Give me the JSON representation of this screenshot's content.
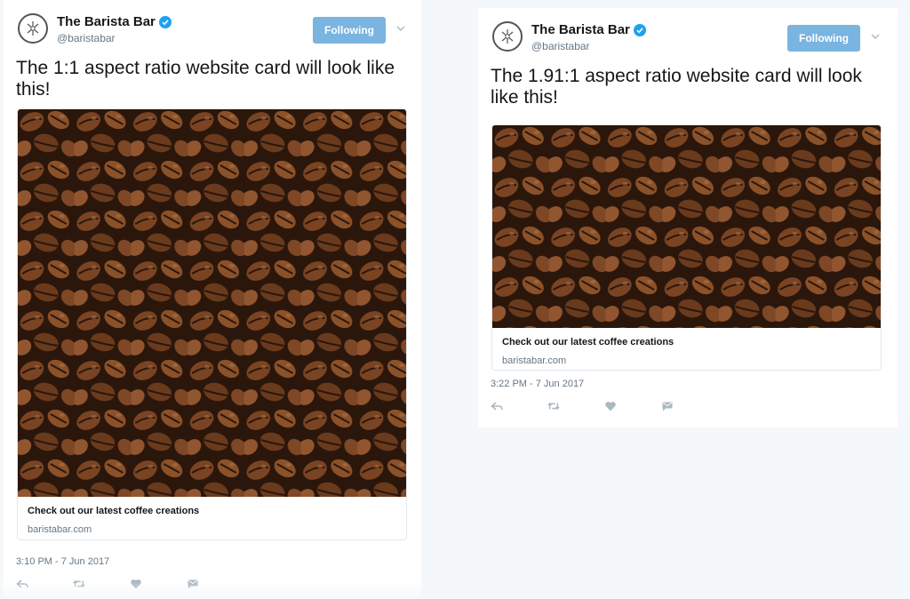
{
  "colors": {
    "follow_button_bg": "#7ab4e0",
    "verified_blue": "#1da1f2",
    "secondary_text": "#657786",
    "page_bg": "#f5f8fa"
  },
  "tweets": [
    {
      "display_name": "The Barista Bar",
      "handle": "@baristabar",
      "follow_label": "Following",
      "text": "The 1:1 aspect ratio website card will look like this!",
      "card": {
        "image": "coffee-beans-square",
        "title": "Check out our latest coffee creations",
        "domain": "baristabar.com"
      },
      "timestamp": "3:10 PM - 7 Jun 2017",
      "actions": [
        "reply-icon",
        "retweet-icon",
        "like-icon",
        "direct-message-icon"
      ]
    },
    {
      "display_name": "The Barista Bar",
      "handle": "@baristabar",
      "follow_label": "Following",
      "text": "The 1.91:1 aspect ratio website card will look like this!",
      "card": {
        "image": "coffee-beans-wide",
        "title": "Check out our latest coffee creations",
        "domain": "baristabar.com"
      },
      "timestamp": "3:22 PM - 7 Jun 2017",
      "actions": [
        "reply-icon",
        "retweet-icon",
        "like-icon",
        "direct-message-icon"
      ]
    }
  ]
}
